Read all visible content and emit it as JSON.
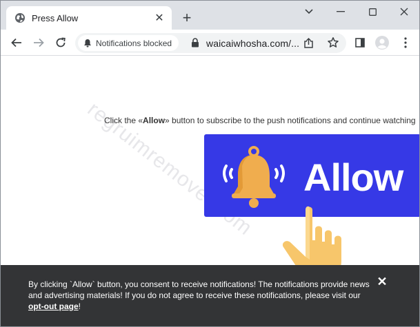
{
  "tab": {
    "title": "Press Allow",
    "favicon": "globe-icon",
    "close_glyph": "✕"
  },
  "newtab_glyph": "+",
  "window_controls": [
    "chevron-down-icon",
    "minimize-icon",
    "maximize-icon",
    "close-icon"
  ],
  "toolbar": {
    "notifications_chip": "Notifications blocked",
    "url": "waicaiwhosha.com/..."
  },
  "page": {
    "watermark": "regruimremover.com",
    "instruction_prefix": "Click the «",
    "instruction_bold": "Allow",
    "instruction_suffix": "» button to subscribe to the push notifications and continue watching",
    "banner_text": "Allow",
    "banner_color": "#3639e6",
    "bell_color": "#f0ad4e"
  },
  "consent": {
    "text": "By clicking `Allow` button, you consent to receive notifications! The notifications provide news and advertising materials! If you do not agree to receive these notifications, please visit our ",
    "link": "opt-out page",
    "suffix": "!",
    "close_glyph": "✕"
  }
}
